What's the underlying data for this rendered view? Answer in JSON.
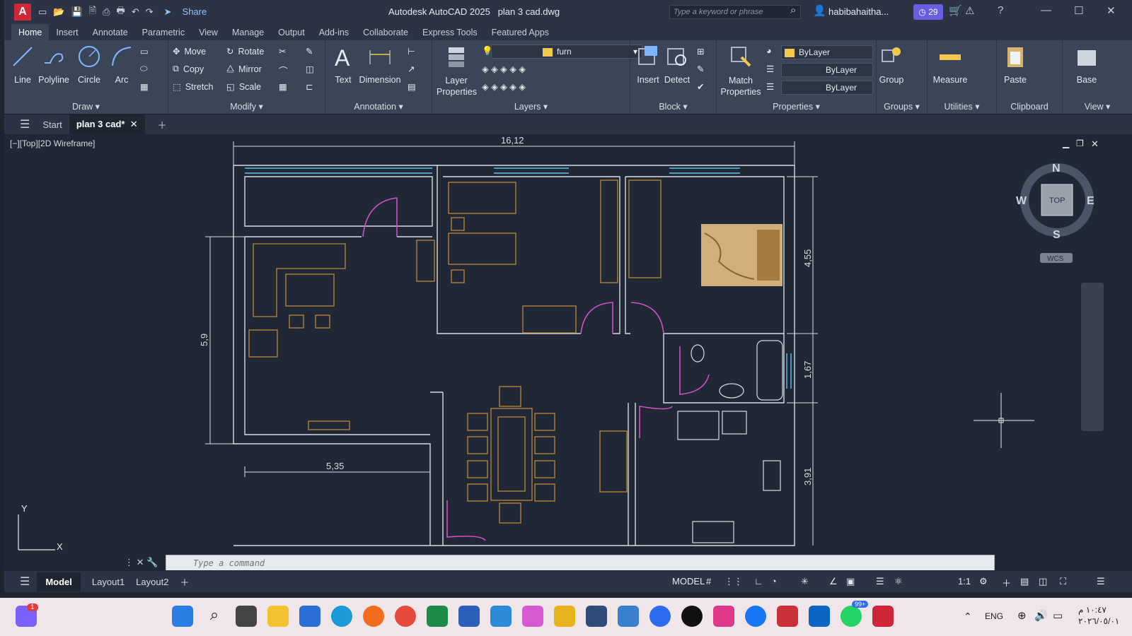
{
  "titlebar": {
    "app_title": "Autodesk AutoCAD 2025",
    "file_title": "plan 3 cad.dwg",
    "share_label": "Share",
    "search_placeholder": "Type a keyword or phrase",
    "user_name": "habibahaitha...",
    "badge_count": "29",
    "logo_letter": "A"
  },
  "ribbon_tabs": [
    "Home",
    "Insert",
    "Annotate",
    "Parametric",
    "View",
    "Manage",
    "Output",
    "Add-ins",
    "Collaborate",
    "Express Tools",
    "Featured Apps"
  ],
  "draw_panel": {
    "title": "Draw",
    "line": "Line",
    "polyline": "Polyline",
    "circle": "Circle",
    "arc": "Arc"
  },
  "modify_panel": {
    "title": "Modify",
    "move": "Move",
    "rotate": "Rotate",
    "copy": "Copy",
    "mirror": "Mirror",
    "stretch": "Stretch",
    "scale": "Scale"
  },
  "annotation_panel": {
    "title": "Annotation",
    "text": "Text",
    "dimension": "Dimension"
  },
  "layers_panel": {
    "title": "Layers",
    "layer_properties": "Layer Properties",
    "current_layer": "furn"
  },
  "block_panel": {
    "title": "Block",
    "insert": "Insert",
    "detect": "Detect"
  },
  "properties_panel": {
    "title": "Properties",
    "match_properties": "Match Properties",
    "color": "ByLayer",
    "linetype": "ByLayer",
    "lineweight": "ByLayer"
  },
  "groups_panel": {
    "title": "Groups",
    "group": "Group"
  },
  "utilities_panel": {
    "title": "Utilities",
    "measure": "Measure"
  },
  "clipboard_panel": {
    "title": "Clipboard",
    "paste": "Paste"
  },
  "view_panel": {
    "title": "View",
    "base": "Base"
  },
  "doc_tabs": {
    "start": "Start",
    "active": "plan 3 cad*"
  },
  "viewport": {
    "label": "[−][Top][2D Wireframe]",
    "viewcube": {
      "top": "TOP",
      "n": "N",
      "s": "S",
      "e": "E",
      "w": "W",
      "wcs": "WCS"
    },
    "ucs": {
      "x": "X",
      "y": "Y"
    }
  },
  "dimensions": {
    "top_width": "16,12",
    "left_height": "5,9",
    "living_width": "5,35",
    "right_1": "4,55",
    "right_2": "1,67",
    "right_3": "3,91"
  },
  "command_line": {
    "placeholder": "Type a command"
  },
  "layout_tabs": {
    "model": "Model",
    "layout1": "Layout1",
    "layout2": "Layout2"
  },
  "status": {
    "model": "MODEL",
    "scale": "1:1"
  },
  "taskbar": {
    "language": "ENG",
    "time": "١٠:٤٧ م",
    "date": "٢٠٢٦/٠٥/٠١",
    "notify_badge": "1",
    "whatsapp_badge": "99+"
  }
}
